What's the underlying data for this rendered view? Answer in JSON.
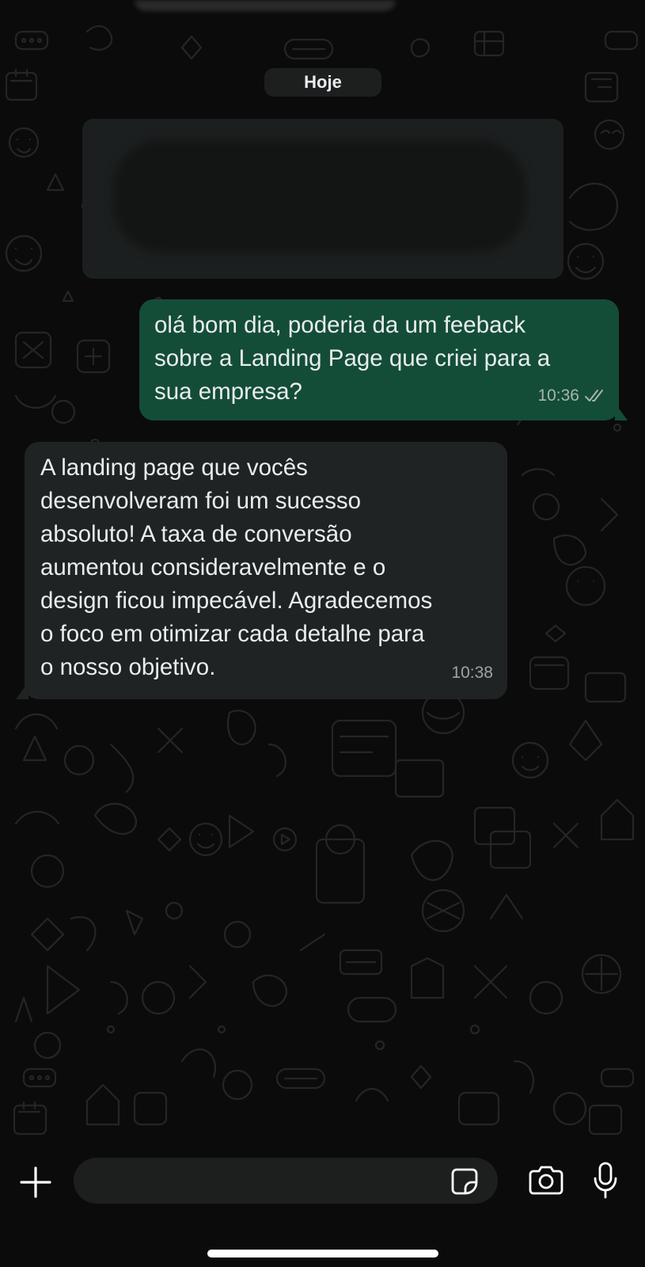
{
  "chat": {
    "date_chip": "Hoje",
    "messages": [
      {
        "direction": "outgoing",
        "text": "olá bom dia, poderia da um  feeback\nsobre a Landing Page que criei para a\nsua empresa?",
        "time": "10:36",
        "status": "read",
        "status_icon": "double-check-icon"
      },
      {
        "direction": "incoming",
        "text": "A landing page que vocês\ndesenvolveram foi um sucesso\nabsoluto! A taxa de conversão\naumentou consideravelmente e o\ndesign ficou impecável. Agradecemos\no foco em otimizar cada detalhe para\no nosso objetivo.",
        "time": "10:38"
      }
    ]
  },
  "composer": {
    "placeholder": "",
    "icons": [
      "plus-icon",
      "sticker-icon",
      "camera-icon",
      "microphone-icon"
    ]
  },
  "colors": {
    "background": "#0b0b0b",
    "outgoing_bubble": "#144d37",
    "incoming_bubble": "#202323",
    "text": "#e9edef",
    "meta_text": "#a8b4b0",
    "date_chip": "#1d1f1f"
  }
}
